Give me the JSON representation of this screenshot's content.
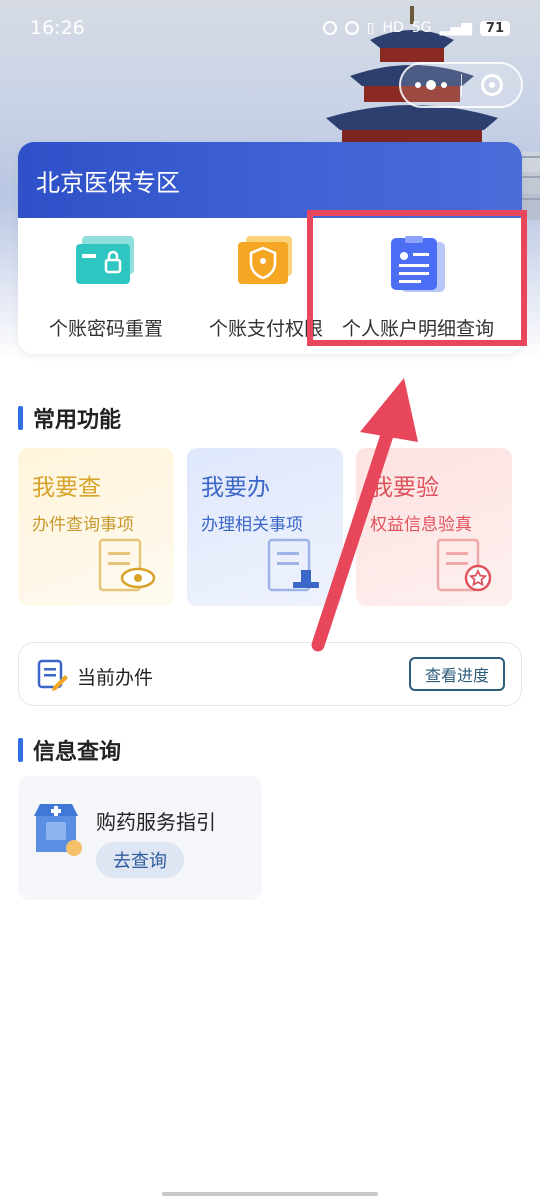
{
  "status_bar": {
    "time": "16:26",
    "network": "5G",
    "hd": "HD",
    "battery": "71"
  },
  "zone": {
    "title": "北京医保专区",
    "items": [
      {
        "label": "个账密码重置",
        "icon": "card-lock-icon",
        "color": "#2fc6c2"
      },
      {
        "label": "个账支付权限",
        "icon": "shield-location-icon",
        "color": "#f5a623"
      },
      {
        "label": "个人账户明细查询",
        "icon": "document-list-icon",
        "color": "#4b6ef5"
      }
    ]
  },
  "common": {
    "title": "常用功能",
    "cards": [
      {
        "title": "我要查",
        "subtitle": "办件查询事项",
        "icon": "document-eye-icon",
        "color": "#d7a228"
      },
      {
        "title": "我要办",
        "subtitle": "办理相关事项",
        "icon": "document-stamp-icon",
        "color": "#3b67c9"
      },
      {
        "title": "我要验",
        "subtitle": "权益信息验真",
        "icon": "document-star-icon",
        "color": "#e0535c"
      }
    ]
  },
  "current_task": {
    "label": "当前办件",
    "button": "查看进度"
  },
  "info": {
    "title": "信息查询",
    "card": {
      "name": "购药服务指引",
      "button": "去查询"
    }
  },
  "colors": {
    "highlight": "#e8465a",
    "accent": "#2f6de1"
  }
}
